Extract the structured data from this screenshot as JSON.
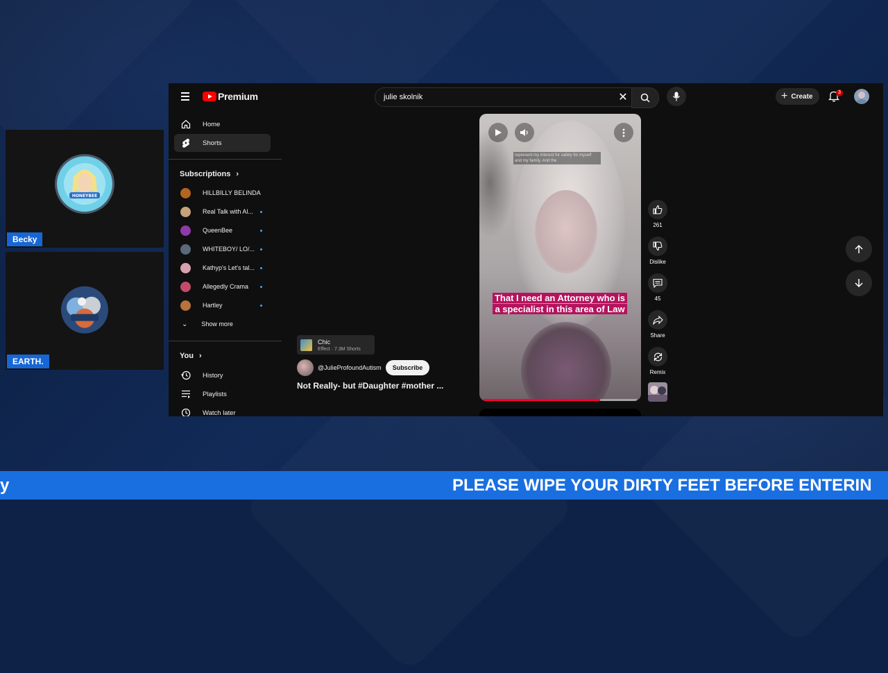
{
  "guests": [
    {
      "name": "Becky"
    },
    {
      "name": "EARTH."
    }
  ],
  "youtube": {
    "logo_text": "Premium",
    "search_value": "julie skolnik",
    "create_label": "Create",
    "notification_count": "3",
    "sidebar": {
      "home": "Home",
      "shorts": "Shorts",
      "subscriptions_heading": "Subscriptions",
      "subscriptions": [
        {
          "name": "HILLBILLY BELINDA",
          "color": "#b5651d",
          "dot": false
        },
        {
          "name": "Real Talk with Al...",
          "color": "#c8a27a",
          "dot": true
        },
        {
          "name": "QueenBee",
          "color": "#8e3aa8",
          "dot": true
        },
        {
          "name": "WHITEBOY/ LO/...",
          "color": "#5a6a7a",
          "dot": true
        },
        {
          "name": "Kathyp's Let's tal...",
          "color": "#d9a0b0",
          "dot": true
        },
        {
          "name": "Allegedly Crama",
          "color": "#c44a6a",
          "dot": true
        },
        {
          "name": "Hartley",
          "color": "#b8723a",
          "dot": true
        }
      ],
      "show_more": "Show more",
      "you_heading": "You",
      "history": "History",
      "playlists": "Playlists",
      "watch_later": "Watch later"
    },
    "short": {
      "caption": "That I need an Attorney who is a specialist in this area of Law",
      "overlay_subtitle": "represent my interest for safety for myself and my family. And the",
      "progress": 0.76,
      "likes": "261",
      "dislike_label": "Dislike",
      "comments": "45",
      "share_label": "Share",
      "remix_label": "Remix",
      "effect_name": "Chic",
      "effect_meta": "Effect · 7.3M Shorts",
      "channel": "@JulieProfoundAutism",
      "subscribe_label": "Subscribe",
      "title": "Not Really- but #Daughter #mother ..."
    }
  },
  "ticker": {
    "left_fragment": "y",
    "text": "PLEASE WIPE YOUR DIRTY FEET BEFORE ENTERIN"
  }
}
